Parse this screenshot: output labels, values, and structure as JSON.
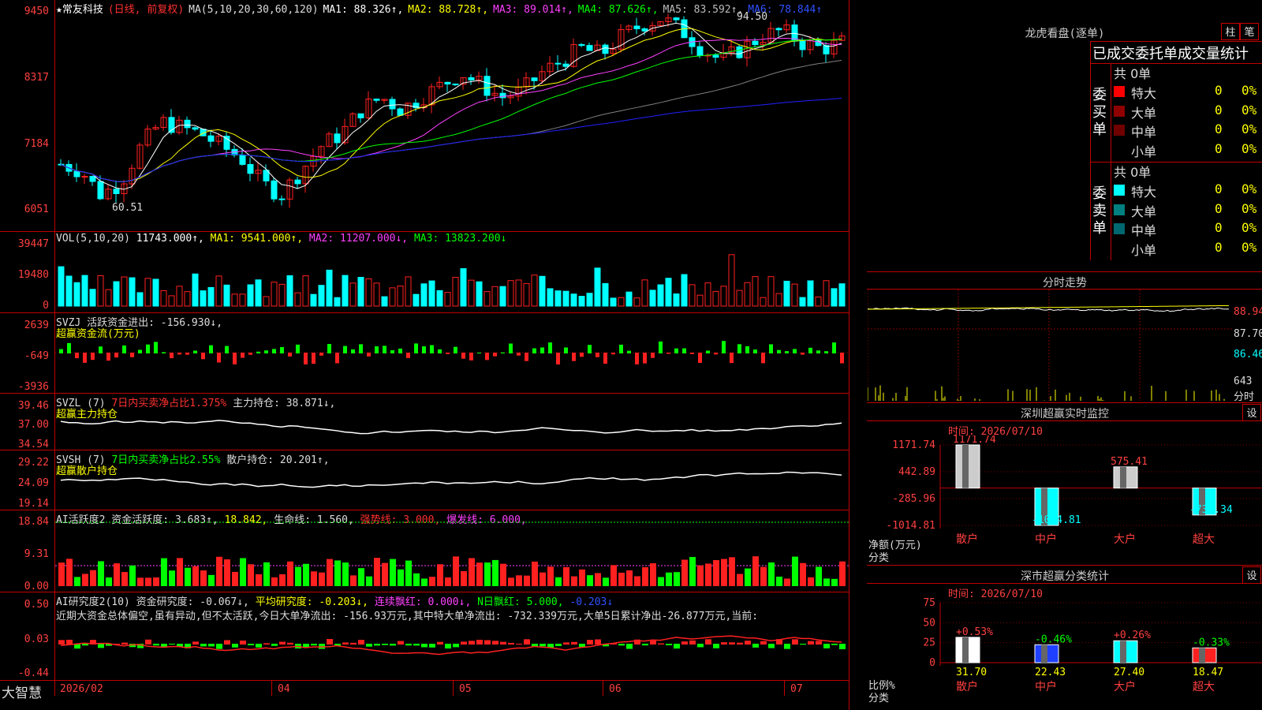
{
  "colors": {
    "up": "#ff2020",
    "down": "#00ffff",
    "ma1": "#ffffff",
    "ma2": "#ffff00",
    "ma3": "#ff40ff",
    "ma4": "#00ff00",
    "ma5": "#808080",
    "ma6": "#2020ff",
    "grid": "#c00000"
  },
  "main": {
    "header": {
      "star": "★",
      "name": "常友科技",
      "mode": "(日线, 前复权)",
      "ma_def": "MA(5,10,20,30,60,120)",
      "ma1": "MA1: 88.326↑,",
      "ma2": "MA2: 88.728↑,",
      "ma3": "MA3: 89.014↑,",
      "ma4": "MA4: 87.626↑,",
      "ma5": "MA5: 83.592↑,",
      "ma6": "MA6: 78.844↑"
    },
    "yticks": [
      "9450",
      "8317",
      "7184",
      "6051"
    ],
    "high_label": "94.50",
    "low_label": "60.51"
  },
  "vol": {
    "header": "VOL(5,10,20)",
    "v": "11743.000↑,",
    "ma1": "MA1: 9541.000↑,",
    "ma2": "MA2: 11207.000↓,",
    "ma3": "MA3: 13823.200↓",
    "yticks": [
      "39447",
      "19480",
      "0"
    ]
  },
  "svzj": {
    "header": "SVZJ  活跃资金进出: -156.930↓,",
    "sub": "超赢资金流(万元)",
    "yticks": [
      "2639",
      "-649",
      "-3936"
    ]
  },
  "svzl": {
    "header_a": "SVZL (7)",
    "header_b": "7日内买卖净占比1.375%",
    "header_c": "主力持仓: 38.871↓,",
    "sub": "超赢主力持仓",
    "yticks": [
      "39.46",
      "37.00",
      "34.54"
    ]
  },
  "svsh": {
    "header_a": "SVSH (7)",
    "header_b": "7日内买卖净占比2.55%",
    "header_c": "散户持仓: 20.201↑,",
    "sub": "超赢散户持仓",
    "yticks": [
      "29.22",
      "24.09",
      "19.14"
    ]
  },
  "ai1": {
    "header_a": "AI活跃度2 资金活跃度: 3.683↑,",
    "header_b": "18.842,",
    "header_c": "生命线: 1.560,",
    "header_d": "强势线: 3.000,",
    "header_e": "爆发线: 6.000,",
    "yticks": [
      "18.84",
      "9.31",
      "0.00"
    ]
  },
  "ai2": {
    "header_a": "AI研究度2(10) 资金研究度: -0.067↓,",
    "header_b": "平均研究度: -0.203↓,",
    "header_c": "连续飘红: 0.000↓,",
    "header_d": "N日飘红: 5.000,",
    "header_e": "-0.203↓",
    "text": "近期大资金总体偏空,虽有异动,但不太活跃,今日大单净流出: -156.93万元,其中特大单净流出: -732.339万元,大单5日累计净出-26.877万元,当前:",
    "yticks": [
      "0.50",
      "0.03",
      "-0.44"
    ]
  },
  "xaxis": [
    "2026/02",
    "04",
    "05",
    "06",
    "07"
  ],
  "brand": "大智慧",
  "right": {
    "longhu_title": "龙虎看盘(逐单)",
    "btn_zhu": "柱",
    "btn_bi": "笔",
    "tabs": "已成交委托单成交量统计",
    "buy": {
      "side": "委买单",
      "total": "共 0单",
      "rows": [
        {
          "label": "特大",
          "v": "0",
          "p": "0%",
          "c": "#ff0000"
        },
        {
          "label": "大单",
          "v": "0",
          "p": "0%",
          "c": "#900000"
        },
        {
          "label": "中单",
          "v": "0",
          "p": "0%",
          "c": "#700000"
        },
        {
          "label": "小单",
          "v": "0",
          "p": "0%",
          "c": "#000"
        }
      ]
    },
    "sell": {
      "side": "委卖单",
      "total": "共 0单",
      "rows": [
        {
          "label": "特大",
          "v": "0",
          "p": "0%",
          "c": "#00ffff"
        },
        {
          "label": "大单",
          "v": "0",
          "p": "0%",
          "c": "#008080"
        },
        {
          "label": "中单",
          "v": "0",
          "p": "0%",
          "c": "#006870"
        },
        {
          "label": "小单",
          "v": "0",
          "p": "0%",
          "c": "#000"
        }
      ]
    },
    "fenshi": {
      "title": "分时走势",
      "p1": "88.94",
      "p2": "87.70",
      "p3": "86.46",
      "v": "643",
      "vl": "分时"
    },
    "sz": {
      "title": "深圳超赢实时监控",
      "btn": "设",
      "time": "时间: 2026/07/10",
      "yticks": [
        "1171.74",
        "442.89",
        "-285.96",
        "-1014.81"
      ],
      "unit": "净额(万元)",
      "cat": "分类",
      "bars": [
        {
          "label": "散户",
          "value": 1171.74,
          "text": "1171.74"
        },
        {
          "label": "中户",
          "value": -1014.81,
          "text": "-1014.81"
        },
        {
          "label": "大户",
          "value": 575.41,
          "text": "575.41"
        },
        {
          "label": "超大",
          "value": -732.34,
          "text": "-732.34"
        }
      ]
    },
    "fl": {
      "title": "深市超赢分类统计",
      "btn": "设",
      "time": "时间: 2026/07/10",
      "yticks": [
        "75",
        "50",
        "25",
        "0"
      ],
      "unit": "比例%",
      "cat": "分类",
      "bars": [
        {
          "label": "散户",
          "value": 31.7,
          "text": "31.70",
          "chg": "+0.53%",
          "c": "#ffffff"
        },
        {
          "label": "中户",
          "value": 22.43,
          "text": "22.43",
          "chg": "-0.46%",
          "c": "#2040ff"
        },
        {
          "label": "大户",
          "value": 27.4,
          "text": "27.40",
          "chg": "+0.26%",
          "c": "#00ffff"
        },
        {
          "label": "超大",
          "value": 18.47,
          "text": "18.47",
          "chg": "-0.33%",
          "c": "#ff2020"
        }
      ]
    }
  }
}
